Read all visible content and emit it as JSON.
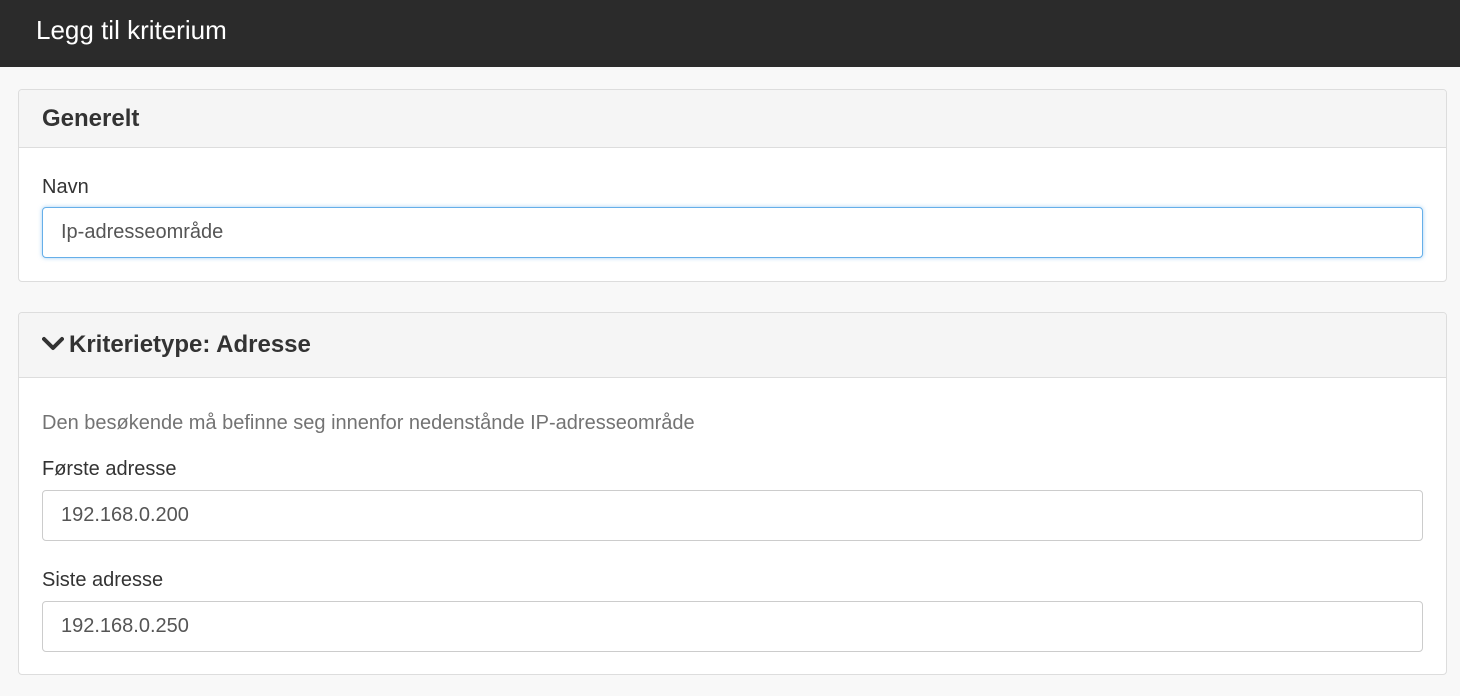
{
  "header": {
    "title": "Legg til kriterium"
  },
  "general": {
    "heading": "Generelt",
    "name_label": "Navn",
    "name_value": "Ip-adresseområde"
  },
  "criteria": {
    "heading": "Kriterietype: Adresse",
    "chevron_icon": "chevron-down-icon",
    "description": "Den besøkende må befinne seg innenfor nedenstånde IP-adresseområde",
    "first_label": "Første adresse",
    "first_value": "192.168.0.200",
    "last_label": "Siste adresse",
    "last_value": "192.168.0.250"
  },
  "colors": {
    "header_bg": "#2b2b2b",
    "focus_border": "#66afe9",
    "panel_heading_bg": "#f5f5f5"
  }
}
